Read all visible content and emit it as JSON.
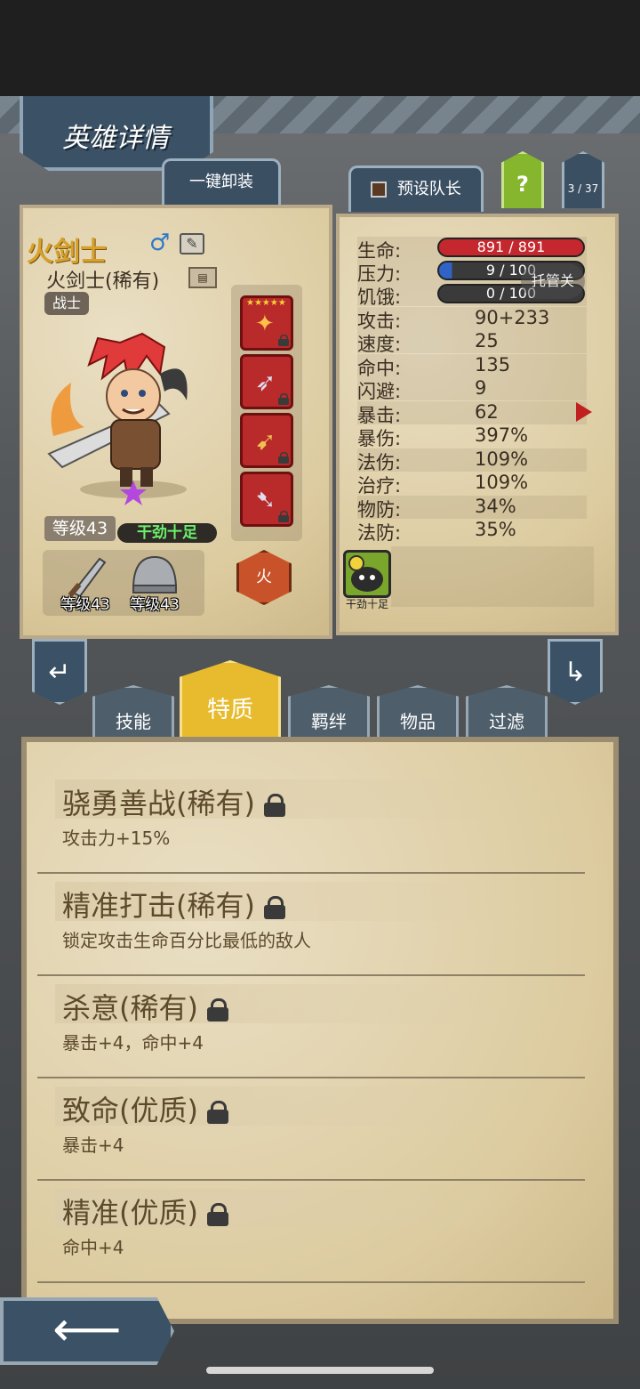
{
  "screen": {
    "title": "英雄详情"
  },
  "header": {
    "unequip_all_label": "一键卸装",
    "preset_leader_label": "预设队长",
    "help_label": "?",
    "page_indicator": "3 / 37"
  },
  "hero": {
    "name": "火剑士",
    "subtitle": "火剑士(稀有)",
    "class": "战士",
    "level": "等级43",
    "mood": "干劲十足",
    "element": "火",
    "gear": [
      {
        "icon": "sword-icon",
        "level": "等级43"
      },
      {
        "icon": "helmet-icon",
        "level": "等级43"
      }
    ]
  },
  "stats": {
    "bars": [
      {
        "label": "生命:",
        "value": "891 / 891",
        "fill": 1.0,
        "color": "#c4282e"
      },
      {
        "label": "压力:",
        "value": "9 / 100",
        "fill": 0.09,
        "color": "#2f63c6"
      },
      {
        "label": "饥饿:",
        "value": "0 / 100",
        "fill": 0.0,
        "color": "#444444"
      }
    ],
    "rows": [
      {
        "label": "攻击:",
        "value": "90+233"
      },
      {
        "label": "速度:",
        "value": "25"
      },
      {
        "label": "命中:",
        "value": "135"
      },
      {
        "label": "闪避:",
        "value": "9"
      },
      {
        "label": "暴击:",
        "value": "62"
      },
      {
        "label": "暴伤:",
        "value": "397%"
      },
      {
        "label": "法伤:",
        "value": "109%"
      },
      {
        "label": "治疗:",
        "value": "109%"
      },
      {
        "label": "物防:",
        "value": "34%"
      },
      {
        "label": "法防:",
        "value": "35%"
      }
    ],
    "auto_label": "托管关",
    "trait_icon_label": "干劲十足"
  },
  "tabs": [
    {
      "label": "技能"
    },
    {
      "label": "特质"
    },
    {
      "label": "羁绊"
    },
    {
      "label": "物品"
    },
    {
      "label": "过滤"
    }
  ],
  "traits": [
    {
      "title": "骁勇善战(稀有)",
      "desc": "攻击力+15%"
    },
    {
      "title": "精准打击(稀有)",
      "desc": "锁定攻击生命百分比最低的敌人"
    },
    {
      "title": "杀意(稀有)",
      "desc": "暴击+4，命中+4"
    },
    {
      "title": "致命(优质)",
      "desc": "暴击+4"
    },
    {
      "title": "精准(优质)",
      "desc": "命中+4"
    }
  ],
  "colors": {
    "accent": "#e7bb2d",
    "panel": "#3a5166",
    "parchment": "#e4d6b6"
  }
}
